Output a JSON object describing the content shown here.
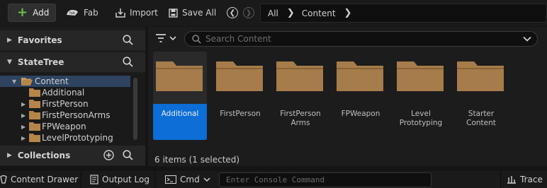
{
  "toolbar": {
    "add_label": "Add",
    "fab_label": "Fab",
    "import_label": "Import",
    "save_all_label": "Save All",
    "breadcrumb": [
      "All",
      "Content"
    ]
  },
  "sidebar": {
    "favorites_label": "Favorites",
    "project_label": "StateTree",
    "collections_label": "Collections",
    "tree": [
      {
        "label": "Content",
        "selected": true,
        "expanded": true
      },
      {
        "label": "Additional",
        "selected": false,
        "expanded": false
      },
      {
        "label": "FirstPerson",
        "selected": false,
        "expanded": false
      },
      {
        "label": "FirstPersonArms",
        "selected": false,
        "expanded": false
      },
      {
        "label": "FPWeapon",
        "selected": false,
        "expanded": false
      },
      {
        "label": "LevelPrototyping",
        "selected": false,
        "expanded": false
      }
    ]
  },
  "content": {
    "search_placeholder": "Search Content",
    "items": [
      {
        "name": "Additional",
        "selected": true
      },
      {
        "name": "FirstPerson",
        "selected": false
      },
      {
        "name": "FirstPerson Arms",
        "selected": false
      },
      {
        "name": "FPWeapon",
        "selected": false
      },
      {
        "name": "Level Prototyping",
        "selected": false
      },
      {
        "name": "Starter Content",
        "selected": false
      }
    ],
    "status": "6 items (1 selected)"
  },
  "bottombar": {
    "content_drawer_label": "Content Drawer",
    "output_log_label": "Output Log",
    "cmd_label": "Cmd",
    "console_placeholder": "Enter Console Command",
    "trace_label": "Trace"
  },
  "colors": {
    "accent_add": "#6bc24d",
    "selection_blue": "#0c6ed6",
    "tree_selection": "#2d4360",
    "folder": "#a67c4a"
  }
}
